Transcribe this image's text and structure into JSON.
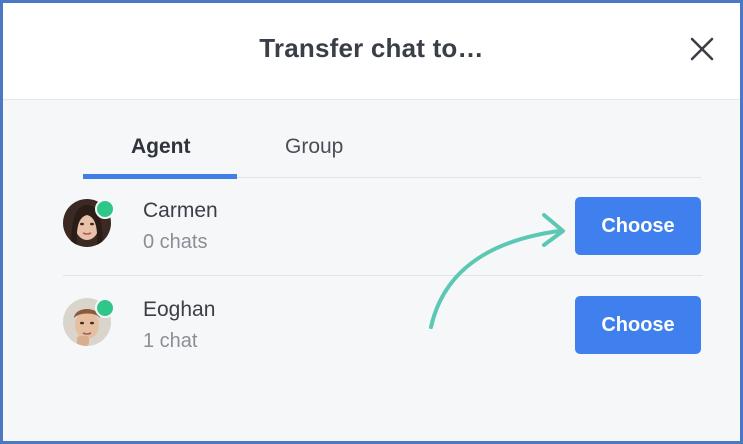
{
  "dialog": {
    "title": "Transfer chat to…",
    "close_icon": "close-icon"
  },
  "tabs": [
    {
      "label": "Agent",
      "active": true
    },
    {
      "label": "Group",
      "active": false
    }
  ],
  "agents": [
    {
      "name": "Carmen",
      "chats": "0 chats",
      "status": "online",
      "button_label": "Choose"
    },
    {
      "name": "Eoghan",
      "chats": "1 chat",
      "status": "online",
      "button_label": "Choose"
    }
  ],
  "colors": {
    "accent": "#3f80ee",
    "online": "#2fc787",
    "arrow": "#5cc8b4",
    "frame": "#4a78c2"
  }
}
